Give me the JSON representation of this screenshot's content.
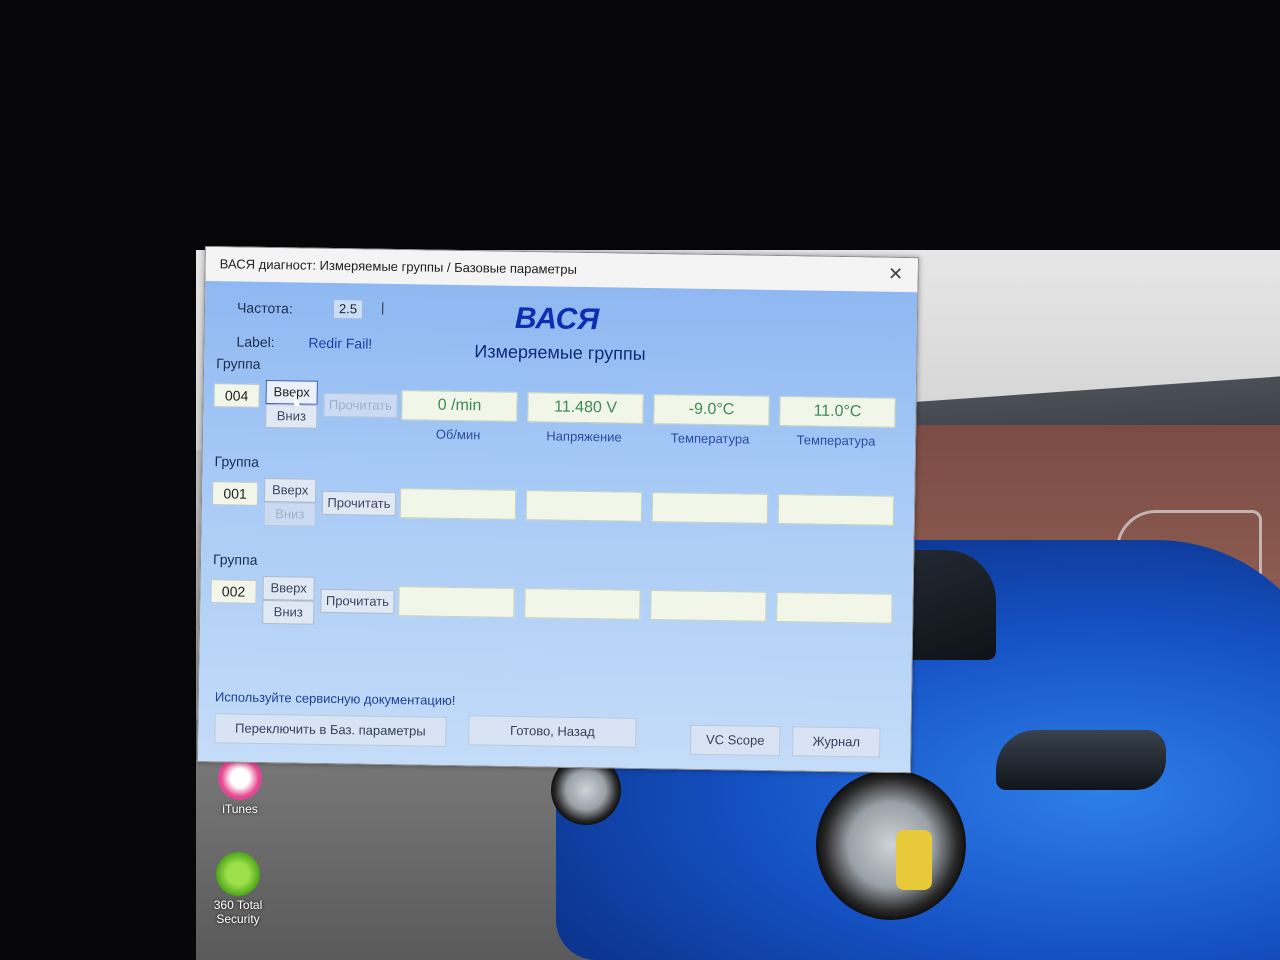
{
  "window": {
    "title": "ВАСЯ диагност: Измеряемые группы / Базовые параметры",
    "close_glyph": "✕"
  },
  "header": {
    "freq_label": "Частота:",
    "freq_value": "2.5",
    "freq_tick": "|",
    "label_label": "Label:",
    "label_value": "Redir Fail!",
    "brand": "ВАСЯ",
    "subtitle": "Измеряемые группы"
  },
  "groups": [
    {
      "heading": "Группа",
      "number": "004",
      "up": "Вверх",
      "down": "Вниз",
      "read": "Прочитать",
      "values": [
        "0 /min",
        "11.480 V",
        "-9.0°C",
        "11.0°C"
      ],
      "units": [
        "Об/мин",
        "Напряжение",
        "Температура",
        "Температура"
      ]
    },
    {
      "heading": "Группа",
      "number": "001",
      "up": "Вверх",
      "down": "Вниз",
      "read": "Прочитать",
      "values": [
        "",
        "",
        "",
        ""
      ],
      "units": [
        "",
        "",
        "",
        ""
      ]
    },
    {
      "heading": "Группа",
      "number": "002",
      "up": "Вверх",
      "down": "Вниз",
      "read": "Прочитать",
      "values": [
        "",
        "",
        "",
        ""
      ],
      "units": [
        "",
        "",
        "",
        ""
      ]
    }
  ],
  "footer": {
    "note": "Используйте сервисную документацию!",
    "switch_button": "Переключить в Баз. параметры",
    "done_button": "Готово, Назад",
    "vcscope_button": "VC Scope",
    "log_button": "Журнал"
  },
  "desktop": {
    "itunes_label": "iTunes",
    "security_label_1": "360 Total",
    "security_label_2": "Security"
  },
  "colors": {
    "client_bg": "#a9cbf6",
    "brand_text": "#0b2fb0",
    "value_text": "#3c8a56"
  }
}
